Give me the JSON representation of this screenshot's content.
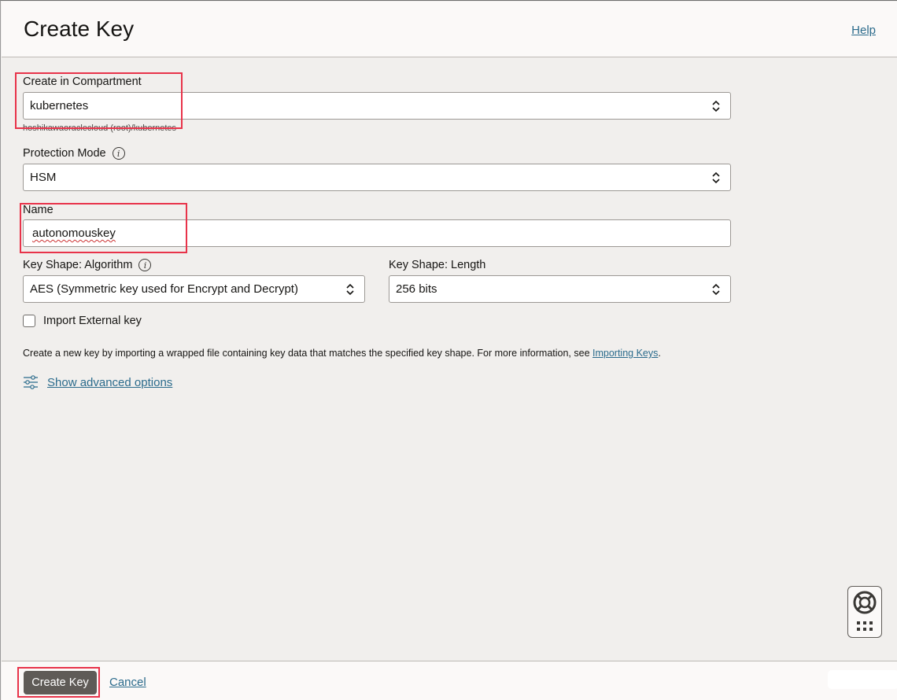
{
  "header": {
    "title": "Create Key",
    "help_label": "Help"
  },
  "compartment": {
    "label": "Create in Compartment",
    "value": "kubernetes",
    "path": "hoshikawaoraclecloud (root)/kubernetes"
  },
  "protection_mode": {
    "label": "Protection Mode",
    "value": "HSM"
  },
  "name": {
    "label": "Name",
    "value": "autonomouskey"
  },
  "algorithm": {
    "label": "Key Shape: Algorithm",
    "value": "AES (Symmetric key used for Encrypt and Decrypt)"
  },
  "length": {
    "label": "Key Shape: Length",
    "value": "256 bits"
  },
  "import_external": {
    "label": "Import External key",
    "checked": false
  },
  "info": {
    "text": "Create a new key by importing a wrapped file containing key data that matches the specified key shape. For more information, see ",
    "link": "Importing Keys",
    "suffix": "."
  },
  "advanced": {
    "label": "Show advanced options",
    "icon": "sliders-icon"
  },
  "footer": {
    "create_label": "Create Key",
    "cancel_label": "Cancel"
  },
  "help_widget": {
    "icon": "lifebuoy-icon",
    "grid_icon": "app-grid-icon"
  },
  "colors": {
    "link": "#2b6b8c",
    "primary_button": "#5f5b57",
    "highlight": "#e8334a",
    "background": "#f1efed"
  }
}
